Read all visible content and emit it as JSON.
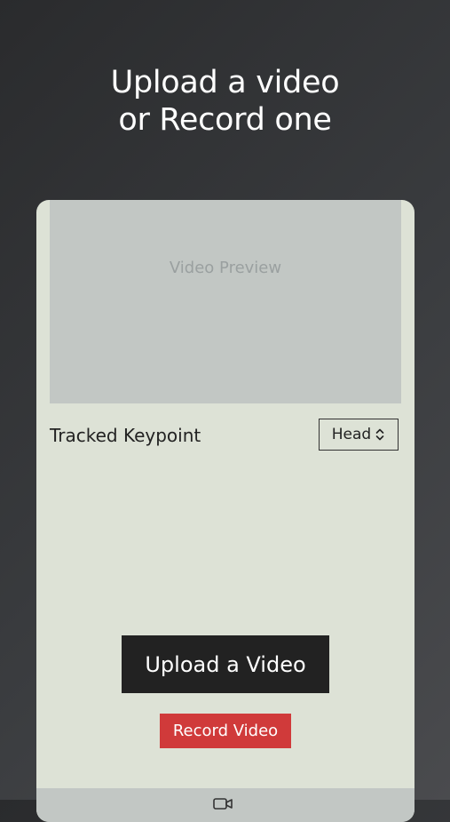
{
  "headline": {
    "line1": "Upload a video",
    "line2": "or Record one"
  },
  "preview": {
    "label": "Video Preview"
  },
  "keypoint": {
    "label": "Tracked Keypoint",
    "selected": "Head",
    "icon": "chevron-updown-icon"
  },
  "actions": {
    "upload_label": "Upload a Video",
    "record_label": "Record Video"
  },
  "bottom_bar": {
    "icon": "camera-icon"
  },
  "colors": {
    "background": "#2f3032",
    "card": "#dde2d6",
    "preview": "#c2c7c4",
    "upload_button": "#222222",
    "record_button": "#d03a3a"
  }
}
